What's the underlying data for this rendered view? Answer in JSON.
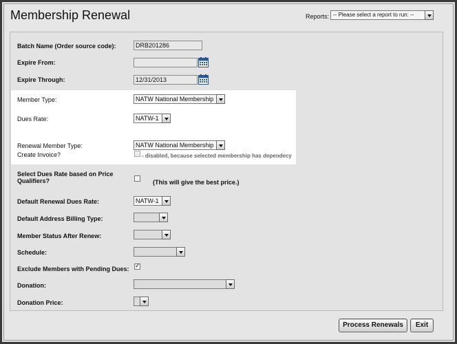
{
  "title": "Membership Renewal",
  "reports": {
    "label": "Reports:",
    "selected": "-- Please select a report to run: --"
  },
  "fields": {
    "batch_name": {
      "label": "Batch Name (Order source code):",
      "value": "DRB201286"
    },
    "expire_from": {
      "label": "Expire From:",
      "value": ""
    },
    "expire_through": {
      "label": "Expire Through:",
      "value": "12/31/2013"
    },
    "member_type": {
      "label": "Member Type:",
      "value": "NATW National Membership"
    },
    "dues_rate": {
      "label": "Dues Rate:",
      "value": "NATW-1"
    },
    "renewal_member_type": {
      "label": "Renewal Member Type:",
      "value": "NATW National Membership"
    },
    "create_invoice": {
      "label": "Create Invoice?",
      "note": "- disabled, because selected membership has dependecy"
    },
    "select_dues_rate": {
      "label": "Select Dues Rate based on Price Qualifiers?",
      "note": "(This will give the best price.)"
    },
    "default_renewal_dues_rate": {
      "label": "Default Renewal Dues Rate:",
      "value": "NATW-1"
    },
    "default_address_billing_type": {
      "label": "Default Address Billing Type:",
      "value": ""
    },
    "member_status_after_renew": {
      "label": "Member Status After Renew:",
      "value": ""
    },
    "schedule": {
      "label": "Schedule:",
      "value": ""
    },
    "exclude_pending_dues": {
      "label": "Exclude Members with Pending Dues:",
      "checked": true
    },
    "donation": {
      "label": "Donation:",
      "value": ""
    },
    "donation_price": {
      "label": "Donation Price:",
      "value": ""
    }
  },
  "buttons": {
    "process": "Process Renewals",
    "exit": "Exit"
  },
  "icons": {
    "calendar": "calendar-icon",
    "dropdown": "chevron-down-icon"
  }
}
